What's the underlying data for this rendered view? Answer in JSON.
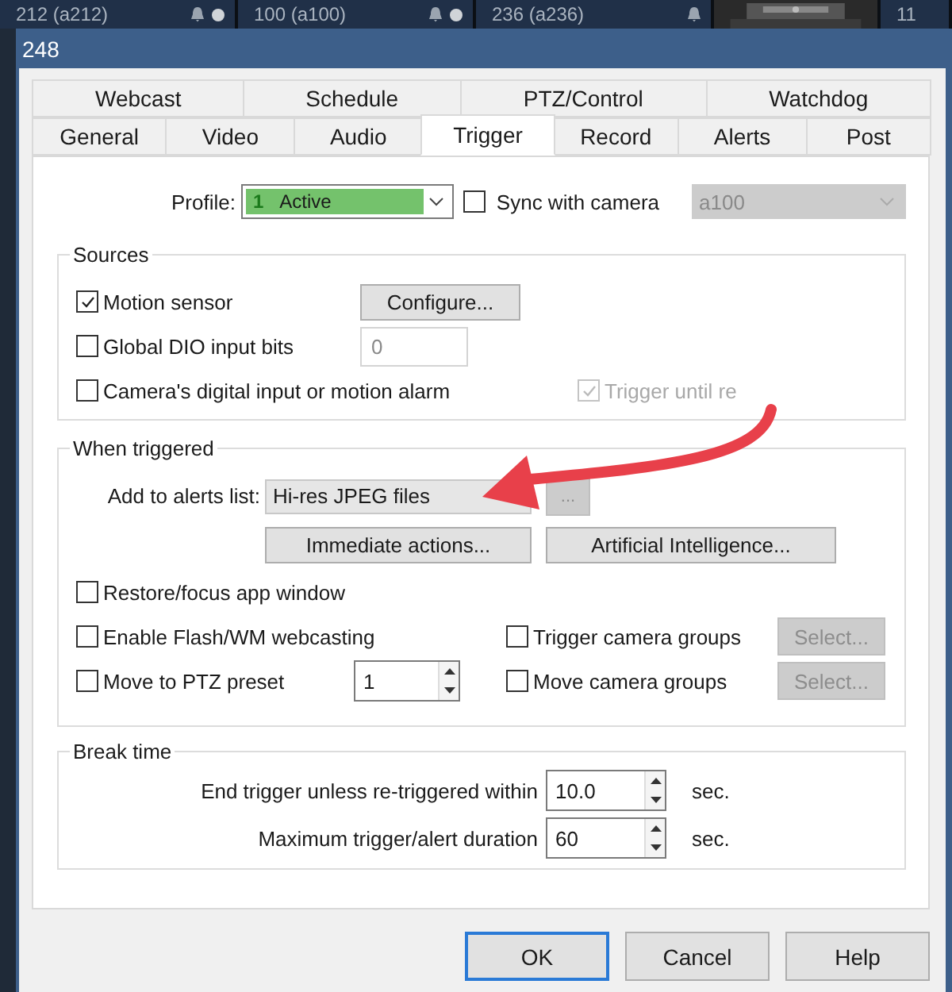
{
  "background_strip": [
    {
      "kind": "bell_dot",
      "label": "212 (a212)"
    },
    {
      "kind": "bell_dot",
      "label": "100 (a100)"
    },
    {
      "kind": "bell",
      "label": "236 (a236)"
    },
    {
      "kind": "picture"
    },
    {
      "kind": "plain",
      "label": "11"
    }
  ],
  "window": {
    "title": "248"
  },
  "tab_rows": [
    {
      "tabs": [
        {
          "label": "Webcast",
          "selected": false
        },
        {
          "label": "Schedule",
          "selected": false
        },
        {
          "label": "PTZ/Control",
          "selected": false
        },
        {
          "label": "Watchdog",
          "selected": false
        }
      ]
    },
    {
      "tabs": [
        {
          "label": "General",
          "selected": false
        },
        {
          "label": "Video",
          "selected": false
        },
        {
          "label": "Audio",
          "selected": false
        },
        {
          "label": "Trigger",
          "selected": true
        },
        {
          "label": "Record",
          "selected": false
        },
        {
          "label": "Alerts",
          "selected": false
        },
        {
          "label": "Post",
          "selected": false
        }
      ]
    }
  ],
  "profile": {
    "label": "Profile:",
    "number": "1",
    "value": "Active"
  },
  "sync": {
    "label": "Sync with camera",
    "checked": false,
    "camera": "a100"
  },
  "sources": {
    "title": "Sources",
    "motion": {
      "label": "Motion sensor",
      "checked": true,
      "button": "Configure..."
    },
    "dio": {
      "label": "Global DIO input bits",
      "checked": false,
      "placeholder": "0"
    },
    "camera_input": {
      "label": "Camera's digital input or motion alarm",
      "checked": false
    },
    "trigger_until": {
      "label": "Trigger until re",
      "checked": true,
      "disabled": true
    }
  },
  "when_triggered": {
    "title": "When triggered",
    "alerts_label": "Add to alerts list:",
    "alerts_value": "Hi-res JPEG files",
    "more_button": {
      "label": "...",
      "disabled": true
    },
    "buttons": [
      "Immediate actions...",
      "Artificial Intelligence..."
    ],
    "restore": {
      "label": "Restore/focus app window",
      "checked": false
    },
    "webcast": {
      "label": "Enable Flash/WM webcasting",
      "checked": false
    },
    "trigger_groups": {
      "label": "Trigger camera groups",
      "checked": false,
      "button": "Select...",
      "disabled": true
    },
    "ptz": {
      "label": "Move to PTZ preset",
      "checked": false,
      "value": "1"
    },
    "move_groups": {
      "label": "Move camera groups",
      "checked": false,
      "button": "Select...",
      "disabled": true
    }
  },
  "break_time": {
    "title": "Break time",
    "rows": [
      {
        "label": "End trigger unless re-triggered within",
        "value": "10.0",
        "unit": "sec."
      },
      {
        "label": "Maximum trigger/alert duration",
        "value": "60",
        "unit": "sec."
      }
    ]
  },
  "buttons": [
    {
      "label": "OK",
      "default": true
    },
    {
      "label": "Cancel",
      "default": false
    },
    {
      "label": "Help",
      "default": false
    }
  ]
}
